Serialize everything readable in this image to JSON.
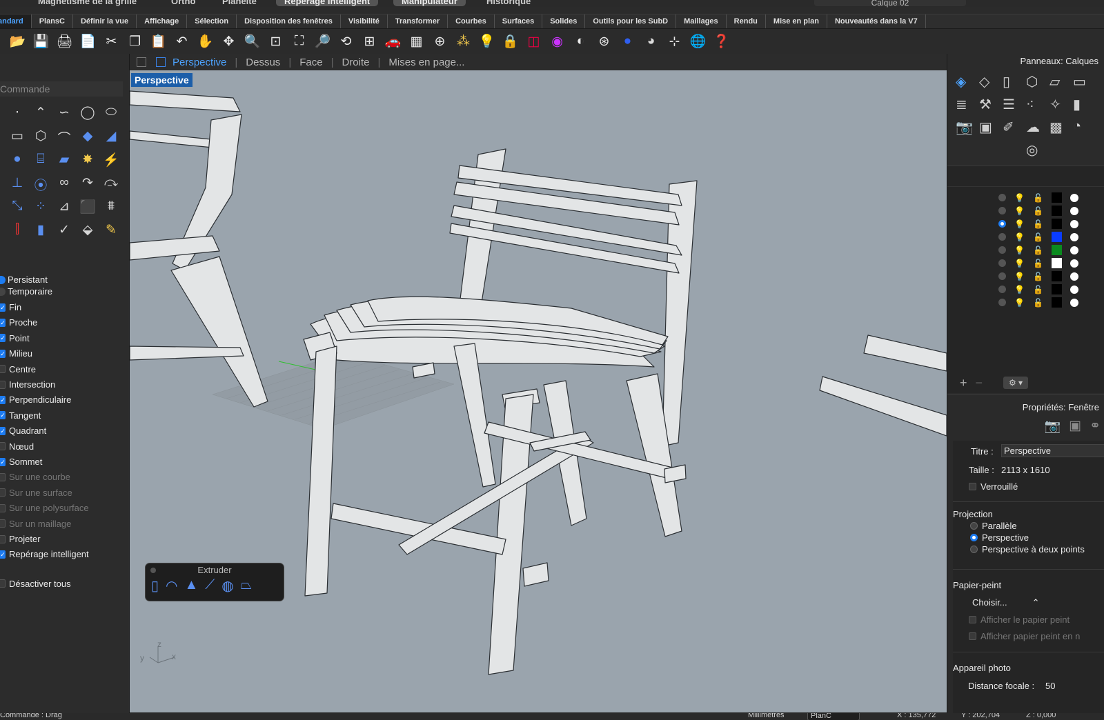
{
  "topbar": {
    "items": [
      "Magnétisme de la grille",
      "Ortho",
      "Planéité",
      "Repérage intelligent",
      "Manipulateur",
      "Historique"
    ],
    "layer_field": "Calque 02"
  },
  "tabs": [
    "Standard",
    "PlansC",
    "Définir la vue",
    "Affichage",
    "Sélection",
    "Disposition des fenêtres",
    "Visibilité",
    "Transformer",
    "Courbes",
    "Surfaces",
    "Solides",
    "Outils pour les SubD",
    "Maillages",
    "Rendu",
    "Mise en plan",
    "Nouveautés dans la V7"
  ],
  "active_tab": "Standard",
  "toolbar_icons": [
    "open-icon",
    "save-icon",
    "print-icon",
    "new-icon",
    "cut-icon",
    "copy-icon",
    "paste-icon",
    "undo-icon",
    "pan-hand-icon",
    "rotate-view-icon",
    "zoom-icon",
    "zoom-window-icon",
    "zoom-extents-icon",
    "zoom-selected-icon",
    "rotate-icon",
    "four-viewports-icon",
    "car-icon",
    "grid-plane-icon",
    "snap-icon",
    "points-icon",
    "lightbulb-icon",
    "lock-icon",
    "layer-stack-icon",
    "color-wheel-icon",
    "shaded-sphere-icon",
    "wireframe-sphere-icon",
    "blue-sphere-icon",
    "render-icon",
    "cplane-icon",
    "globe-icon",
    "help-icon"
  ],
  "viewport_tabs": {
    "items": [
      "Perspective",
      "Dessus",
      "Face",
      "Droite",
      "Mises en page..."
    ],
    "active": "Perspective"
  },
  "command": {
    "placeholder": "Commande"
  },
  "osnap": {
    "mode": [
      {
        "label": "Persistant",
        "on": true
      },
      {
        "label": "Temporaire",
        "on": false
      }
    ],
    "items": [
      {
        "label": "Fin",
        "checked": true,
        "enabled": true
      },
      {
        "label": "Proche",
        "checked": true,
        "enabled": true
      },
      {
        "label": "Point",
        "checked": true,
        "enabled": true
      },
      {
        "label": "Milieu",
        "checked": true,
        "enabled": true
      },
      {
        "label": "Centre",
        "checked": false,
        "enabled": true
      },
      {
        "label": "Intersection",
        "checked": false,
        "enabled": true
      },
      {
        "label": "Perpendiculaire",
        "checked": true,
        "enabled": true
      },
      {
        "label": "Tangent",
        "checked": true,
        "enabled": true
      },
      {
        "label": "Quadrant",
        "checked": true,
        "enabled": true
      },
      {
        "label": "Nœud",
        "checked": false,
        "enabled": true
      },
      {
        "label": "Sommet",
        "checked": true,
        "enabled": true
      },
      {
        "label": "Sur une courbe",
        "checked": false,
        "enabled": false
      },
      {
        "label": "Sur une surface",
        "checked": false,
        "enabled": false
      },
      {
        "label": "Sur une polysurface",
        "checked": false,
        "enabled": false
      },
      {
        "label": "Sur un maillage",
        "checked": false,
        "enabled": false
      },
      {
        "label": "Projeter",
        "checked": false,
        "enabled": true
      },
      {
        "label": "Repérage intelligent",
        "checked": true,
        "enabled": true
      }
    ],
    "disable_all": "Désactiver tous"
  },
  "viewport": {
    "label": "Perspective"
  },
  "extruder": {
    "title": "Extruder"
  },
  "axis": {
    "z": "z",
    "y": "y",
    "x": "x"
  },
  "panels": {
    "title": "Panneaux: Calques",
    "layers": [
      {
        "current": false,
        "bulb": "off",
        "color": "#000000"
      },
      {
        "current": false,
        "bulb": "off",
        "color": "#000000"
      },
      {
        "current": true,
        "bulb": "dim",
        "color": "#000000"
      },
      {
        "current": false,
        "bulb": "on",
        "color": "#0a3cff"
      },
      {
        "current": false,
        "bulb": "on",
        "color": "#0a8a1e"
      },
      {
        "current": false,
        "bulb": "on",
        "color": "#ffffff"
      },
      {
        "current": false,
        "bulb": "on",
        "color": "#000000"
      },
      {
        "current": false,
        "bulb": "on",
        "color": "#000000"
      },
      {
        "current": false,
        "bulb": "on",
        "color": "#000000"
      }
    ]
  },
  "properties": {
    "title": "Propriétés: Fenêtre",
    "titre_label": "Titre :",
    "titre_value": "Perspective",
    "taille_label": "Taille :",
    "taille_value": "2113 x 1610",
    "verrouille": "Verrouillé",
    "projection_heading": "Projection",
    "projection_options": [
      {
        "label": "Parallèle",
        "on": false
      },
      {
        "label": "Perspective",
        "on": true
      },
      {
        "label": "Perspective à deux points",
        "on": false
      }
    ],
    "papier_heading": "Papier-peint",
    "papier_select": "Choisir...",
    "papier_show": "Afficher le papier peint",
    "papier_show2": "Afficher papier peint en n",
    "camera_heading": "Appareil photo",
    "focal_label": "Distance focale :",
    "focal_value": "50"
  },
  "status": {
    "command": "Commande : Drag",
    "units": "Millimètres",
    "cplane": "PlanC",
    "x": "X : 135,772",
    "y": "Y : 202,704",
    "z": "Z : 0,000"
  }
}
